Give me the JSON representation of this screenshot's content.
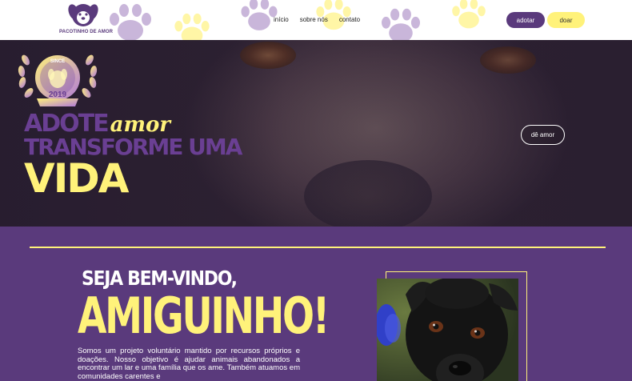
{
  "header": {
    "logo_text": "PACOTINHO DE AMOR",
    "nav": [
      {
        "label": "início"
      },
      {
        "label": "sobre nós"
      },
      {
        "label": "contato"
      }
    ],
    "adotar_label": "adotar",
    "doar_label": "doar"
  },
  "hero": {
    "badge_since": "SINCE",
    "badge_year": "2019",
    "adote": "ADOTE",
    "amor": "amor",
    "transforme": "TRANSFORME UMA",
    "vida": "VIDA",
    "cta_label": "dê amor"
  },
  "welcome": {
    "line1": "SEJA BEM-VINDO,",
    "line2": "AMIGUINHO!",
    "description": "Somos um projeto voluntário mantido por recursos próprios e doações. Nosso objetivo é ajudar animais abandonados a encontrar um lar e uma família que os ame. Também atuamos em comunidades carentes e"
  },
  "colors": {
    "purple": "#5a3a7c",
    "yellow": "#fff27a",
    "white": "#ffffff"
  },
  "icons": [
    "paw-icon",
    "dog-logo-icon",
    "laurel-badge-icon"
  ]
}
